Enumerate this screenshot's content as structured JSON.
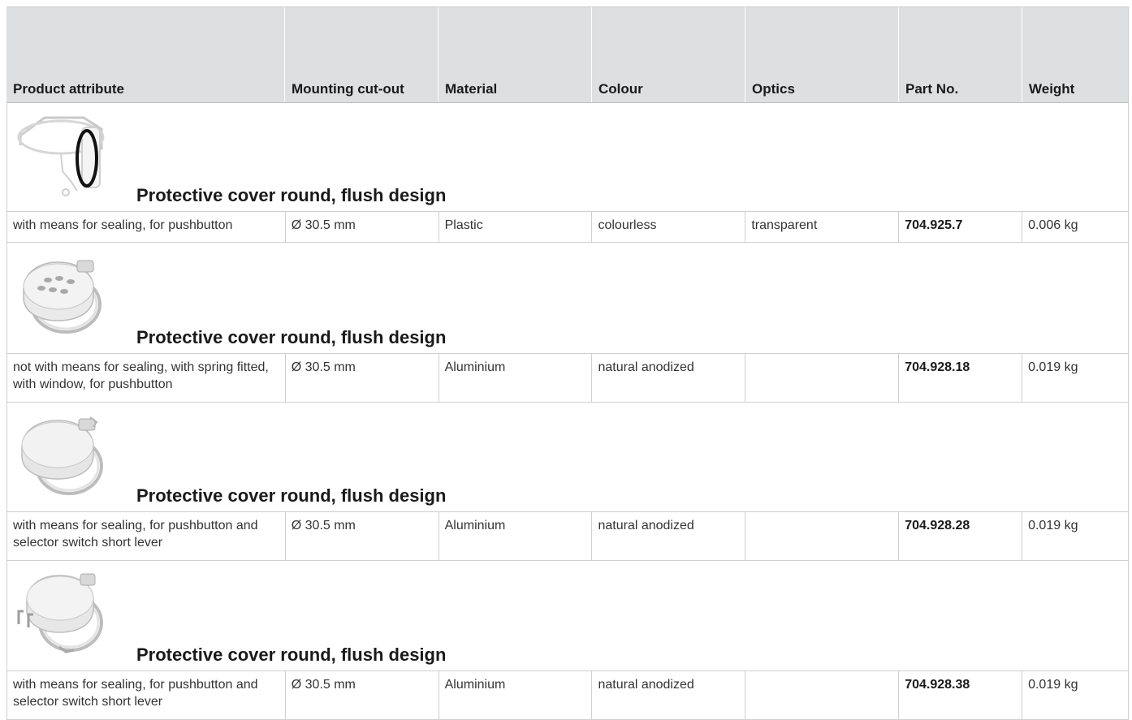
{
  "header": {
    "product_attribute": "Product attribute",
    "mounting_cutout": "Mounting cut-out",
    "material": "Material",
    "colour": "Colour",
    "optics": "Optics",
    "part_no": "Part No.",
    "weight": "Weight"
  },
  "groups": [
    {
      "title": "Protective cover round, flush design",
      "image": "protective-cover-transparent-image",
      "row": {
        "product_attribute": "with means for sealing, for pushbutton",
        "mounting_cutout": "Ø 30.5 mm",
        "material": "Plastic",
        "colour": "colourless",
        "optics": "transparent",
        "part_no": "704.925.7",
        "weight": "0.006 kg"
      }
    },
    {
      "title": "Protective cover round, flush design",
      "image": "protective-cover-window-image",
      "row": {
        "product_attribute": "not with means for sealing, with spring fitted, with window, for pushbutton",
        "mounting_cutout": "Ø 30.5 mm",
        "material": "Aluminium",
        "colour": "natural anodized",
        "optics": "",
        "part_no": "704.928.18",
        "weight": "0.019 kg"
      }
    },
    {
      "title": "Protective cover round, flush design",
      "image": "protective-cover-solid-image",
      "row": {
        "product_attribute": "with means for sealing, for pushbutton and selector switch short lever",
        "mounting_cutout": "Ø 30.5 mm",
        "material": "Aluminium",
        "colour": "natural anodized",
        "optics": "",
        "part_no": "704.928.28",
        "weight": "0.019 kg"
      }
    },
    {
      "title": "Protective cover round, flush design",
      "image": "protective-cover-hinged-image",
      "row": {
        "product_attribute": "with means for sealing, for pushbutton and selector switch short lever",
        "mounting_cutout": "Ø 30.5 mm",
        "material": "Aluminium",
        "colour": "natural anodized",
        "optics": "",
        "part_no": "704.928.38",
        "weight": "0.019 kg"
      }
    }
  ]
}
